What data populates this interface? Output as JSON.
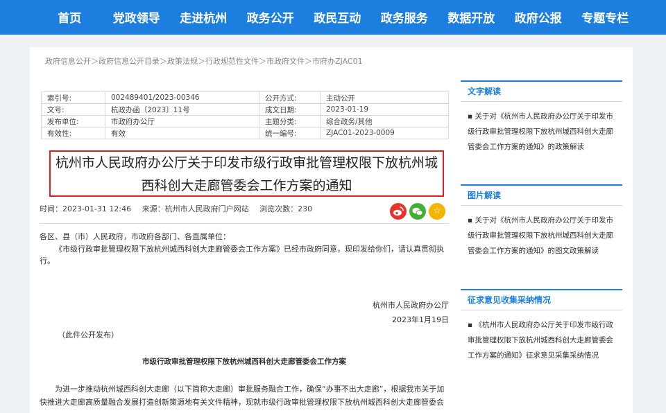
{
  "nav": [
    "首页",
    "党政领导",
    "走进杭州",
    "政务公开",
    "政民互动",
    "政务服务",
    "数据开放",
    "政府公报",
    "专题专栏"
  ],
  "breadcrumb": "政府信息公开＞政府信息公开目录＞政策法规＞行政规范性文件＞市政府文件＞市府办ZJAC01",
  "meta": {
    "index_label": "索引号:",
    "index_value": "002489401/2023-00346",
    "method_label": "公开方式:",
    "method_value": "主动公开",
    "docno_label": "文号:",
    "docno_value": "杭政办函〔2023〕11号",
    "date_label": "成文日期:",
    "date_value": "2023-01-19",
    "issuer_label": "发布单位:",
    "issuer_value": "市政府办公厅",
    "topic_label": "主题分类:",
    "topic_value": "综合政务/其他",
    "valid_label": "有效性:",
    "valid_value": "有效",
    "uid_label": "统一编号:",
    "uid_value": "ZJAC01-2023-0009"
  },
  "title_line1": "杭州市人民政府办公厅关于印发市级行政审批管理权限下放杭州城",
  "title_line2": "西科创大走廊管委会工作方案的通知",
  "info": {
    "time": "时间：2023-01-31 12:46",
    "source": "来源：杭州市人民政府门户网站",
    "views": "浏览次数：230"
  },
  "share_icons": [
    "weibo-icon",
    "wechat-icon",
    "star-icon"
  ],
  "content": {
    "address": "各区、县（市）人民政府，市政府各部门、各直属单位：",
    "para1": "《市级行政审批管理权限下放杭州城西科创大走廊管委会工作方案》已经市政府同意，现印发给你们，请认真贯彻执行。",
    "sign_org": "杭州市人民政府办公厅",
    "sign_date": "2023年1月19日",
    "pub_note": "（此件公开发布）",
    "doc_title": "市级行政审批管理权限下放杭州城西科创大走廊管委会工作方案",
    "para2": "为进一步推动杭州城西科创大走廊（以下简称大走廊）审批服务融合工作，确保“办事不出大走廊”，根据我市关于加快推进大走廊高质量融合发展打造创新策源地有关文件精神，现就市级行政审批管理权限下放杭州城西科创大走廊管委会"
  },
  "sidebar": {
    "text_head": "文字解读",
    "text_item": "▪ 关于对《杭州市人民政府办公厅关于印发市级行政审批管理权限下放杭州城西科创大走廊管委会工作方案的通知》的政策解读",
    "image_head": "图片解读",
    "image_item": "▪ 关于对《杭州市人民政府办公厅关于印发市级行政审批管理权限下放杭州城西科创大走廊管委会工作方案的通知》的图文政策解读",
    "opinion_head": "征求意见收集采纳情况",
    "opinion_item": "▪ 《杭州市人民政府办公厅关于印发市级行政审批管理权限下放杭州城西科创大走廊管委会工作方案的通知》征求意见采集采纳情况"
  }
}
